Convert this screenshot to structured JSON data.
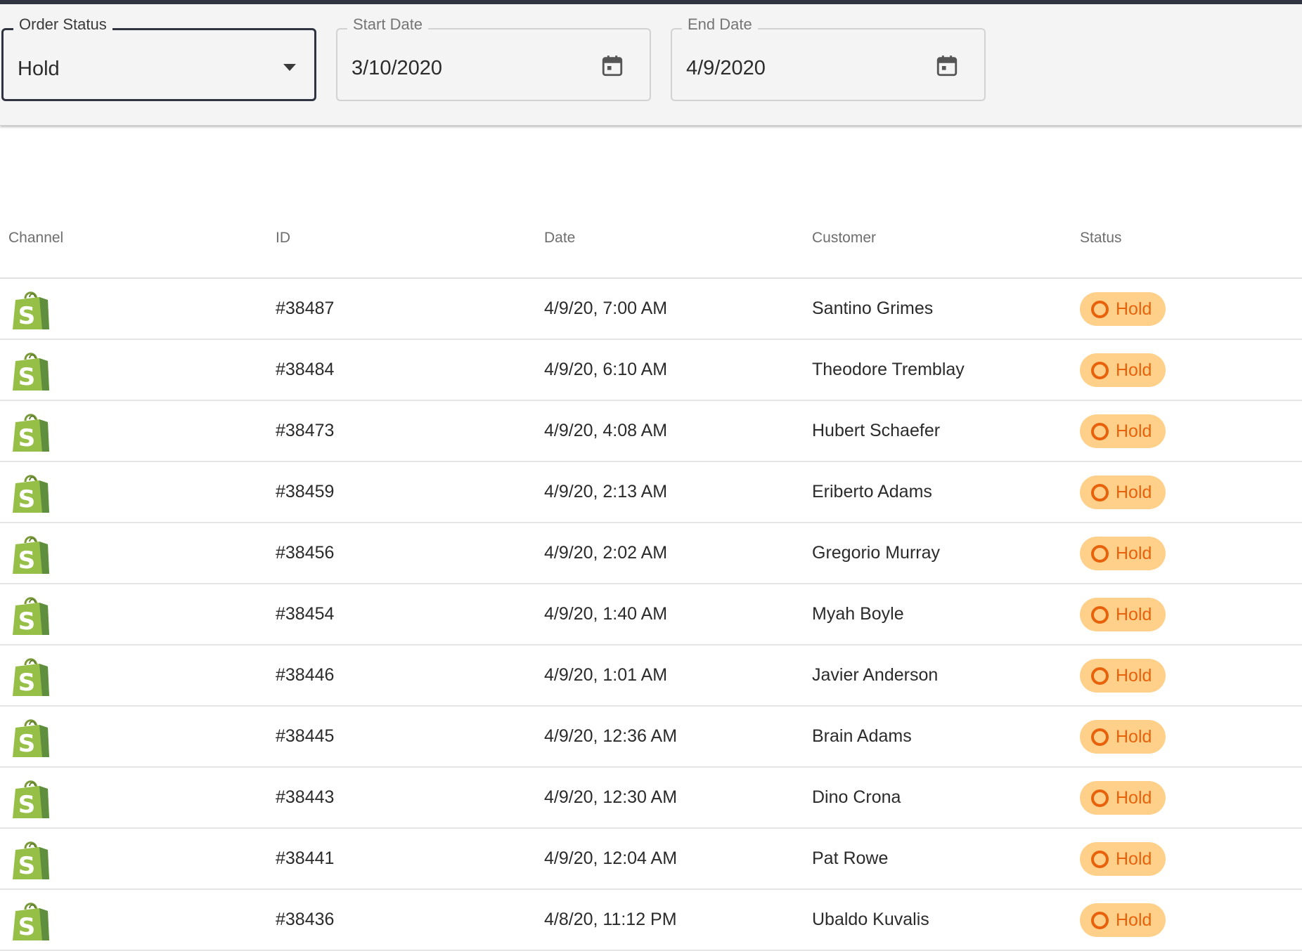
{
  "filters": {
    "order_status": {
      "label": "Order Status",
      "value": "Hold"
    },
    "start_date": {
      "label": "Start Date",
      "value": "3/10/2020"
    },
    "end_date": {
      "label": "End Date",
      "value": "4/9/2020"
    }
  },
  "table": {
    "columns": [
      "Channel",
      "ID",
      "Date",
      "Customer",
      "Status"
    ],
    "rows": [
      {
        "channel_icon": "shopify-bag-icon",
        "id": "#38487",
        "date": "4/9/20, 7:00 AM",
        "customer": "Santino Grimes",
        "status": "Hold"
      },
      {
        "channel_icon": "shopify-bag-icon",
        "id": "#38484",
        "date": "4/9/20, 6:10 AM",
        "customer": "Theodore Tremblay",
        "status": "Hold"
      },
      {
        "channel_icon": "shopify-bag-icon",
        "id": "#38473",
        "date": "4/9/20, 4:08 AM",
        "customer": "Hubert Schaefer",
        "status": "Hold"
      },
      {
        "channel_icon": "shopify-bag-icon",
        "id": "#38459",
        "date": "4/9/20, 2:13 AM",
        "customer": "Eriberto Adams",
        "status": "Hold"
      },
      {
        "channel_icon": "shopify-bag-icon",
        "id": "#38456",
        "date": "4/9/20, 2:02 AM",
        "customer": "Gregorio Murray",
        "status": "Hold"
      },
      {
        "channel_icon": "shopify-bag-icon",
        "id": "#38454",
        "date": "4/9/20, 1:40 AM",
        "customer": "Myah Boyle",
        "status": "Hold"
      },
      {
        "channel_icon": "shopify-bag-icon",
        "id": "#38446",
        "date": "4/9/20, 1:01 AM",
        "customer": "Javier Anderson",
        "status": "Hold"
      },
      {
        "channel_icon": "shopify-bag-icon",
        "id": "#38445",
        "date": "4/9/20, 12:36 AM",
        "customer": "Brain Adams",
        "status": "Hold"
      },
      {
        "channel_icon": "shopify-bag-icon",
        "id": "#38443",
        "date": "4/9/20, 12:30 AM",
        "customer": "Dino Crona",
        "status": "Hold"
      },
      {
        "channel_icon": "shopify-bag-icon",
        "id": "#38441",
        "date": "4/9/20, 12:04 AM",
        "customer": "Pat Rowe",
        "status": "Hold"
      },
      {
        "channel_icon": "shopify-bag-icon",
        "id": "#38436",
        "date": "4/8/20, 11:12 PM",
        "customer": "Ubaldo Kuvalis",
        "status": "Hold"
      }
    ]
  },
  "colors": {
    "focus_border": "#2f3440",
    "status_hold_bg": "#ffd08a",
    "status_hold_fg": "#e8620c",
    "shopify_green": "#95bf47"
  }
}
